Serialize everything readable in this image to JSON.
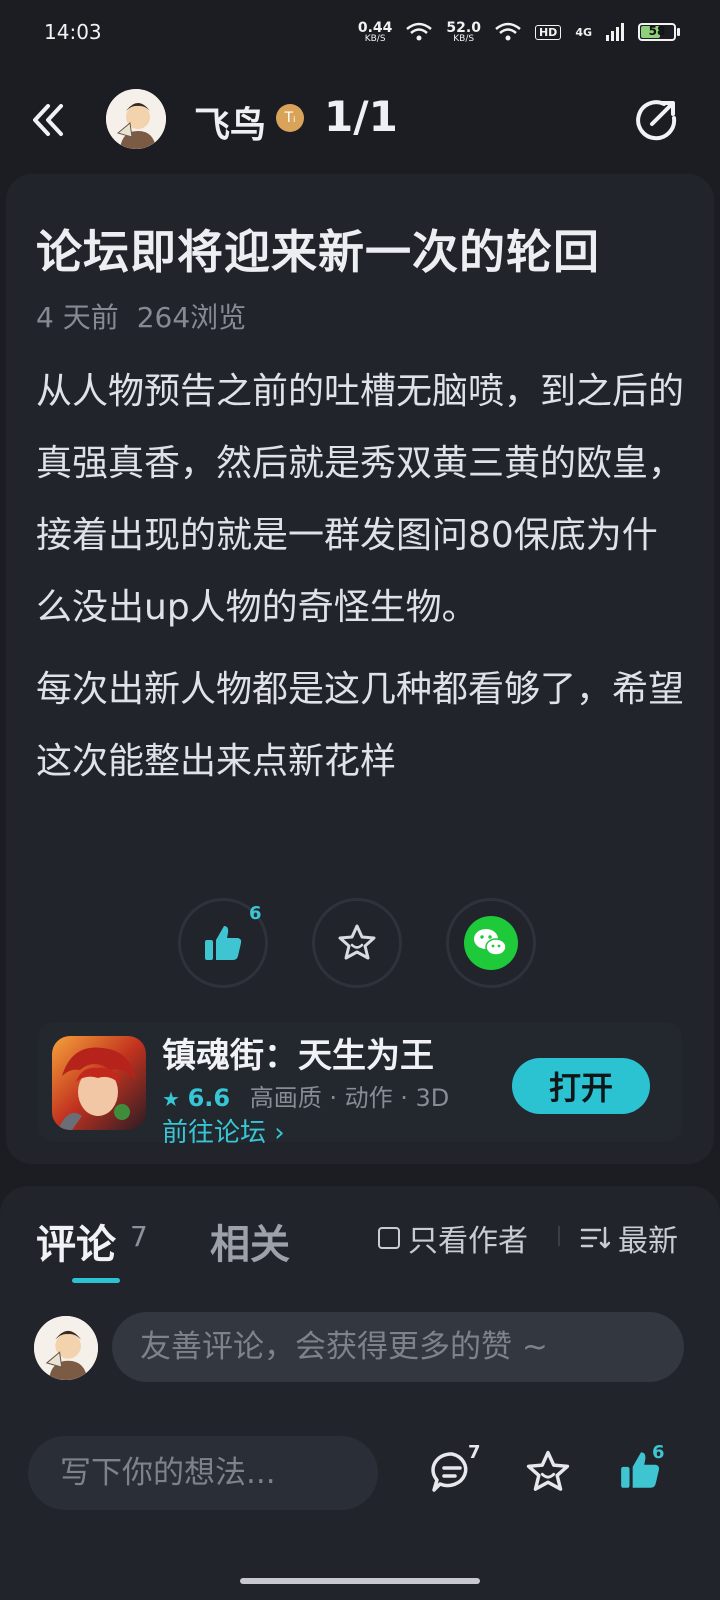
{
  "status_bar": {
    "time": "14:03",
    "net_speed_1": "0.44",
    "net_speed_2": "52.0",
    "speed_unit": "KB/S",
    "hd_label": "HD",
    "network_label": "4G",
    "battery_level": "58"
  },
  "nav": {
    "author_name": "飞鸟",
    "level_badge": "Tᵢ",
    "page_counter": "1/1"
  },
  "post": {
    "title": "论坛即将迎来新一次的轮回",
    "time_ago": "4 天前",
    "views": "264浏览",
    "paragraphs": [
      "从人物预告之前的吐槽无脑喷，到之后的真强真香，然后就是秀双黄三黄的欧皇，接着出现的就是一群发图问80保底为什么没出up人物的奇怪生物。",
      "每次出新人物都是这几种都看够了，希望这次能整出来点新花样"
    ],
    "like_count": "6"
  },
  "game": {
    "title": "镇魂街：天生为王",
    "rating": "6.6",
    "tags": "高画质 · 动作 · 3D",
    "forum_link": "前往论坛 ›",
    "open_label": "打开"
  },
  "comments": {
    "tab_comments": "评论",
    "comment_count": "7",
    "tab_related": "相关",
    "author_only": "只看作者",
    "sort_label": "最新",
    "input_placeholder": "友善评论，会获得更多的赞 ~"
  },
  "bottom_bar": {
    "write_placeholder": "写下你的想法...",
    "comment_count": "7",
    "like_count": "6"
  },
  "colors": {
    "background": "#1b1d23",
    "card": "#21242b",
    "accent": "#2bc2d1",
    "wechat_green": "#1ec93a"
  },
  "icons": [
    "back-icon",
    "share-icon",
    "like-icon",
    "star-icon",
    "wechat-icon",
    "comment-icon",
    "sort-icon"
  ]
}
